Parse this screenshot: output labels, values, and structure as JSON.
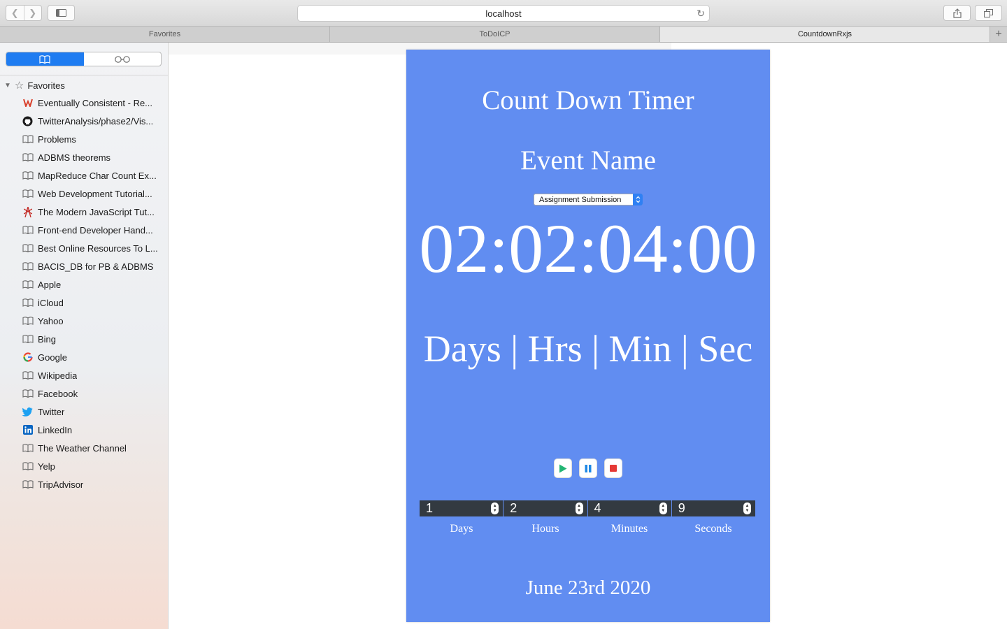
{
  "browser": {
    "address": "localhost",
    "tabs": [
      "Favorites",
      "ToDoICP",
      "CountdownRxjs"
    ],
    "active_tab": 2
  },
  "sidebar": {
    "section_title": "Favorites",
    "items": [
      {
        "label": "Eventually Consistent - Re...",
        "icon": "w-logo-icon"
      },
      {
        "label": "TwitterAnalysis/phase2/Vis...",
        "icon": "github-icon"
      },
      {
        "label": "Problems",
        "icon": "book-icon"
      },
      {
        "label": "ADBMS theorems",
        "icon": "book-icon"
      },
      {
        "label": "MapReduce Char Count Ex...",
        "icon": "book-icon"
      },
      {
        "label": "Web Development Tutorial...",
        "icon": "book-icon"
      },
      {
        "label": "The Modern JavaScript Tut...",
        "icon": "tower-icon"
      },
      {
        "label": "Front-end Developer Hand...",
        "icon": "book-icon"
      },
      {
        "label": "Best Online Resources To L...",
        "icon": "book-icon"
      },
      {
        "label": "BACIS_DB for PB & ADBMS",
        "icon": "book-icon"
      },
      {
        "label": "Apple",
        "icon": "book-icon"
      },
      {
        "label": "iCloud",
        "icon": "book-icon"
      },
      {
        "label": "Yahoo",
        "icon": "book-icon"
      },
      {
        "label": "Bing",
        "icon": "book-icon"
      },
      {
        "label": "Google",
        "icon": "google-icon"
      },
      {
        "label": "Wikipedia",
        "icon": "book-icon"
      },
      {
        "label": "Facebook",
        "icon": "book-icon"
      },
      {
        "label": "Twitter",
        "icon": "twitter-icon"
      },
      {
        "label": "LinkedIn",
        "icon": "linkedin-icon"
      },
      {
        "label": "The Weather Channel",
        "icon": "book-icon"
      },
      {
        "label": "Yelp",
        "icon": "book-icon"
      },
      {
        "label": "TripAdvisor",
        "icon": "book-icon"
      }
    ]
  },
  "app": {
    "title": "Count Down Timer",
    "event_heading": "Event Name",
    "event_selected": "Assignment Submission",
    "timer": "02:02:04:00",
    "units": "Days | Hrs | Min | Sec",
    "inputs": [
      {
        "value": "1",
        "label": "Days"
      },
      {
        "value": "2",
        "label": "Hours"
      },
      {
        "value": "4",
        "label": "Minutes"
      },
      {
        "value": "9",
        "label": "Seconds"
      }
    ],
    "date": "June 23rd 2020",
    "colors": {
      "card": "#618df1",
      "play": "#22b573",
      "pause": "#1e88e5",
      "stop": "#e53935"
    }
  }
}
